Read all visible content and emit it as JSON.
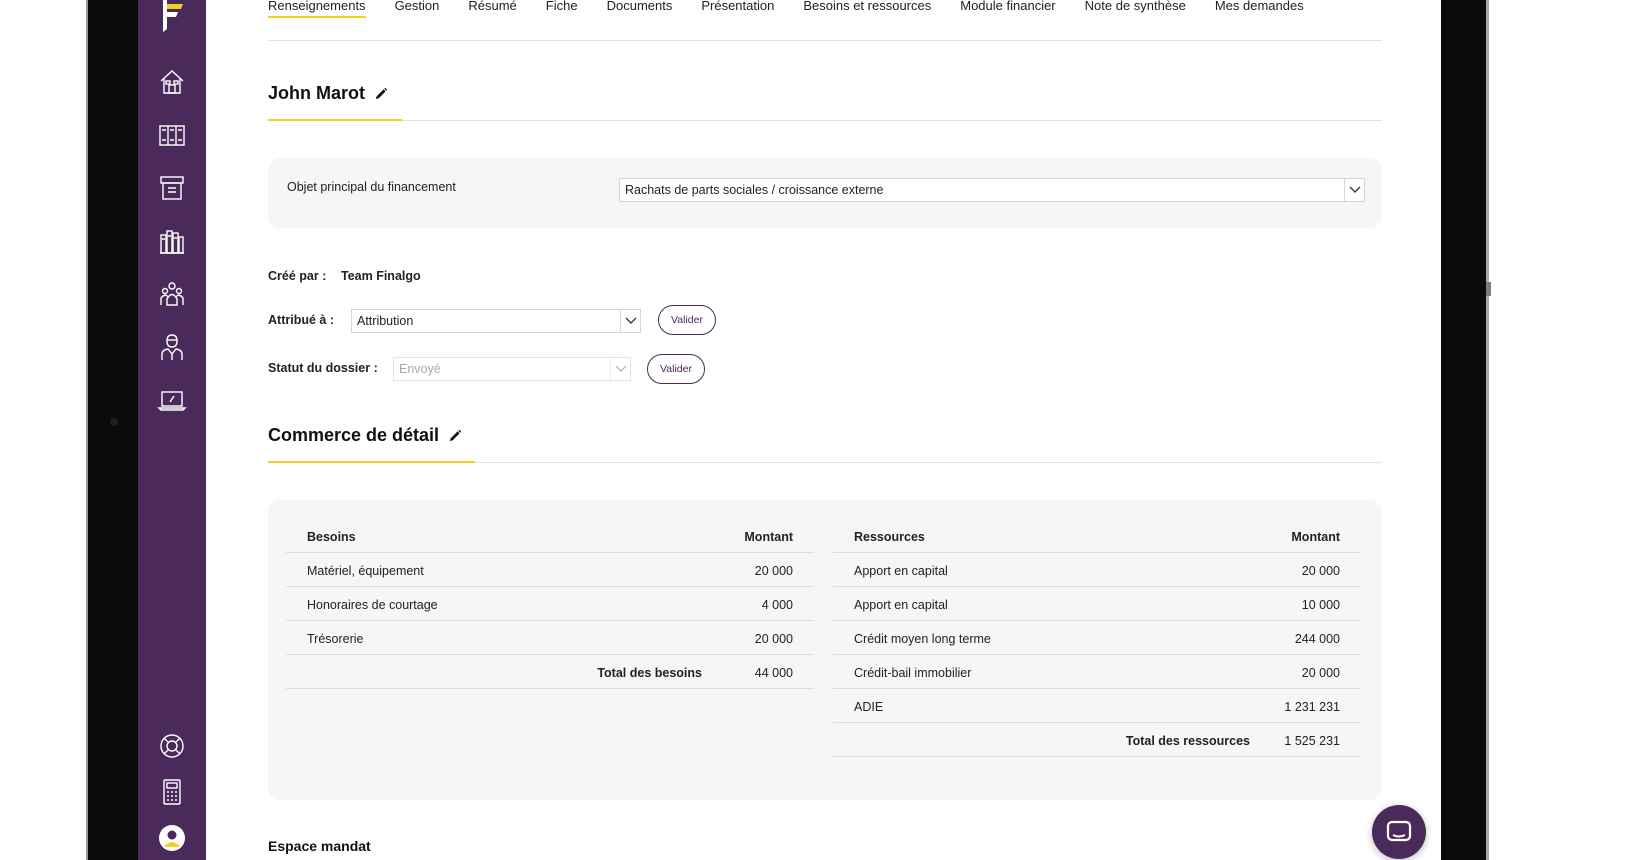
{
  "tabs": [
    {
      "label": "Renseignements",
      "active": true
    },
    {
      "label": "Gestion"
    },
    {
      "label": "Résumé"
    },
    {
      "label": "Fiche"
    },
    {
      "label": "Documents"
    },
    {
      "label": "Présentation"
    },
    {
      "label": "Besoins et ressources"
    },
    {
      "label": "Module financier"
    },
    {
      "label": "Note de synthèse"
    },
    {
      "label": "Mes demandes"
    }
  ],
  "sidebar": {
    "icons": [
      "home-icon",
      "files-icon",
      "archive-icon",
      "library-icon",
      "team-icon",
      "advisor-icon",
      "laptop-icon"
    ],
    "bottom_icons": [
      "lifebuoy-icon",
      "calculator-icon",
      "user-avatar-icon"
    ]
  },
  "client": {
    "name": "John Marot",
    "financing_label": "Objet principal du financement",
    "financing_value": "Rachats de parts sociales / croissance externe",
    "created_by_label": "Créé par :",
    "created_by_value": "Team Finalgo",
    "assigned_label": "Attribué à :",
    "assigned_value": "Attribution",
    "status_label": "Statut du dossier :",
    "status_value": "Envoyé",
    "validate_label": "Valider"
  },
  "business": {
    "title": "Commerce de détail",
    "besoins": {
      "header_label": "Besoins",
      "header_amount": "Montant",
      "rows": [
        {
          "label": "Matériel, équipement",
          "amount": "20 000"
        },
        {
          "label": "Honoraires de courtage",
          "amount": "4 000"
        },
        {
          "label": "Trésorerie",
          "amount": "20 000"
        }
      ],
      "total_label": "Total des besoins",
      "total_amount": "44 000"
    },
    "ressources": {
      "header_label": "Ressources",
      "header_amount": "Montant",
      "rows": [
        {
          "label": "Apport en capital",
          "amount": "20 000"
        },
        {
          "label": "Apport en capital",
          "amount": "10 000"
        },
        {
          "label": "Crédit moyen long terme",
          "amount": "244 000"
        },
        {
          "label": "Crédit-bail immobilier",
          "amount": "20 000"
        },
        {
          "label": "ADIE",
          "amount": "1 231 231"
        }
      ],
      "total_label": "Total des ressources",
      "total_amount": "1 525 231"
    }
  },
  "espace_mandat": "Espace mandat",
  "colors": {
    "sidebar": "#4a2a5a",
    "accent": "#f4cf1f",
    "panel": "#f6f6f6"
  }
}
